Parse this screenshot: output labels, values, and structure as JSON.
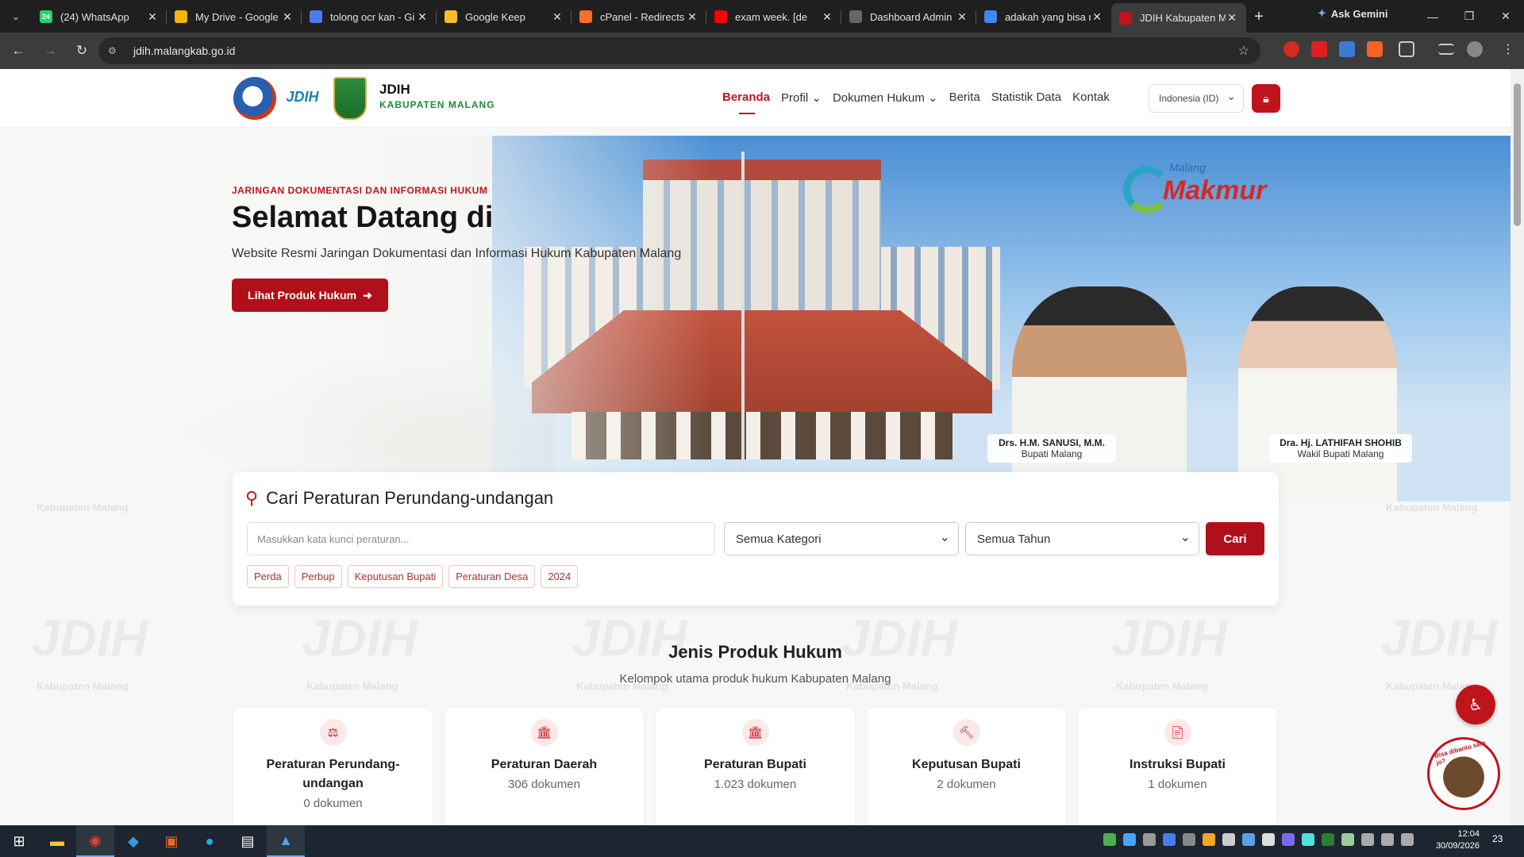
{
  "browser": {
    "tabs": [
      {
        "title": "(24) WhatsApp",
        "icon": "whatsapp-icon",
        "color": "#25d366",
        "badge": "24"
      },
      {
        "title": "My Drive - Google",
        "icon": "google-drive-icon",
        "color": "#f4b400",
        "badge": ""
      },
      {
        "title": "tolong ocr kan - Gi",
        "icon": "gemini-icon",
        "color": "#4a7cf0",
        "badge": ""
      },
      {
        "title": "Google Keep",
        "icon": "keep-icon",
        "color": "#f6bf26",
        "badge": ""
      },
      {
        "title": "cPanel - Redirects",
        "icon": "cpanel-icon",
        "color": "#ff6c2c",
        "badge": ""
      },
      {
        "title": "exam week. [de",
        "icon": "youtube-icon",
        "color": "#ff0000",
        "badge": ""
      },
      {
        "title": "Dashboard Admin",
        "icon": "admin-icon",
        "color": "#666666",
        "badge": ""
      },
      {
        "title": "adakah yang bisa n",
        "icon": "google-icon",
        "color": "#4285f4",
        "badge": ""
      },
      {
        "title": "JDIH Kabupaten M",
        "icon": "jdih-icon",
        "color": "#c0141c",
        "badge": ""
      }
    ],
    "gemini_label": "Ask Gemini",
    "url": "jdih.malangkab.go.id"
  },
  "site": {
    "brand_title": "JDIH",
    "brand_subtitle": "KABUPATEN MALANG",
    "logo2_text": "JDIH",
    "nav": [
      "Beranda",
      "Profil ⌄",
      "Dokumen Hukum ⌄",
      "Berita",
      "Statistik Data",
      "Kontak"
    ],
    "language": "Indonesia (ID)",
    "accent_color": "#c0141c"
  },
  "hero": {
    "eyebrow": "JARINGAN DOKUMENTASI DAN INFORMASI HUKUM",
    "title": "Selamat Datang di",
    "subtitle": "Website Resmi Jaringan Dokumentasi dan Informasi Hukum Kabupaten Malang",
    "cta_label": "Lihat Produk Hukum",
    "slogan_small": "Malang",
    "slogan_big": "Makmur",
    "officials": [
      {
        "name": "Drs. H.M. SANUSI, M.M.",
        "role": "Bupati Malang"
      },
      {
        "name": "Dra. Hj. LATHIFAH SHOHIB",
        "role": "Wakil Bupati Malang"
      }
    ]
  },
  "search": {
    "title": "Cari Peraturan Perundang-undangan",
    "placeholder": "Masukkan kata kunci peraturan...",
    "category": "Semua Kategori",
    "year": "Semua Tahun",
    "button": "Cari",
    "chips": [
      "Perda",
      "Perbup",
      "Keputusan Bupati",
      "Peraturan Desa",
      "2024"
    ]
  },
  "watermark": {
    "logo": "JDIH",
    "caption": "Kabupaten Malang"
  },
  "products": {
    "title": "Jenis Produk Hukum",
    "subtitle": "Kelompok utama produk hukum Kabupaten Malang",
    "items": [
      {
        "title": "Peraturan Perundang-undangan",
        "count": "0 dokumen",
        "icon": "scale-icon"
      },
      {
        "title": "Peraturan Daerah",
        "count": "306 dokumen",
        "icon": "landmark-icon"
      },
      {
        "title": "Peraturan Bupati",
        "count": "1.023 dokumen",
        "icon": "landmark-icon"
      },
      {
        "title": "Keputusan Bupati",
        "count": "2 dokumen",
        "icon": "gavel-icon"
      },
      {
        "title": "Instruksi Bupati",
        "count": "1 dokumen",
        "icon": "file-icon"
      }
    ]
  },
  "mascot": {
    "bubble": "Bisa dibantu sam jo?"
  },
  "taskbar": {
    "time": "12:04",
    "date": "30/09/2026",
    "notifications": "23"
  }
}
